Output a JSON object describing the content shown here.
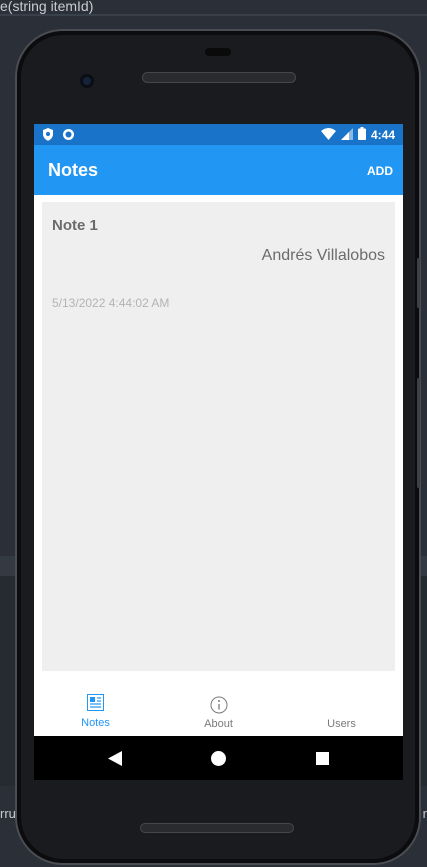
{
  "background": {
    "code_line": "e(string itemId)",
    "left_fragment": "rru",
    "right_fragment": "r"
  },
  "status_bar": {
    "time": "4:44",
    "left_icons": [
      "shield-icon",
      "circle-notification-icon"
    ],
    "right_icons": [
      "wifi-icon",
      "signal-icon",
      "battery-icon"
    ]
  },
  "app_bar": {
    "title": "Notes",
    "action_label": "ADD",
    "color": "#2196f3"
  },
  "notes": [
    {
      "title": "Note 1",
      "text": "Andrés Villalobos",
      "date": "5/13/2022 4:44:02 AM"
    }
  ],
  "tabs": [
    {
      "label": "Notes",
      "icon": "notes-list-icon",
      "active": true
    },
    {
      "label": "About",
      "icon": "info-icon",
      "active": false
    },
    {
      "label": "Users",
      "icon": "",
      "active": false
    }
  ],
  "nav_bar": {
    "buttons": [
      "back-icon",
      "home-icon",
      "recents-icon"
    ]
  },
  "colors": {
    "status_bar": "#1873c9",
    "accent": "#2196f3",
    "card": "#efefef"
  }
}
